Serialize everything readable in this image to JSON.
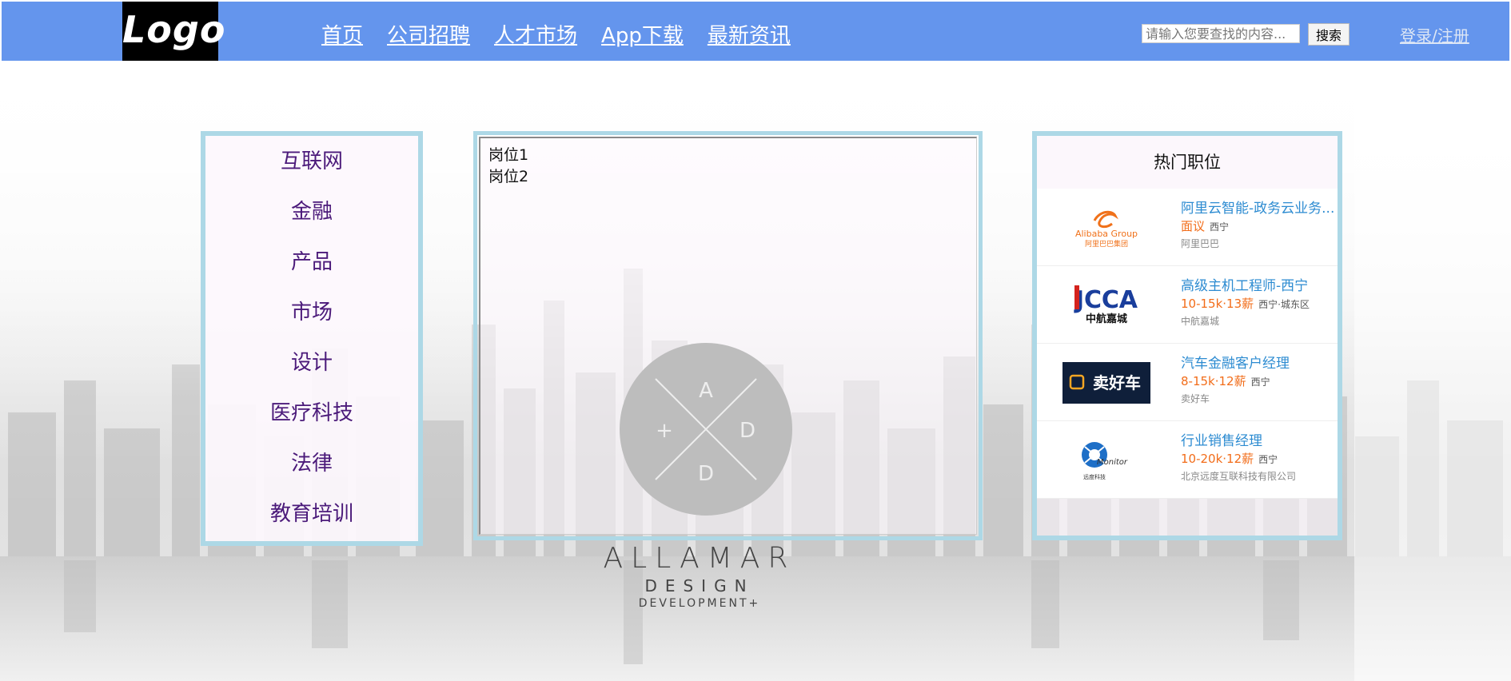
{
  "header": {
    "logo_text": "Logo",
    "nav": [
      "首页",
      "公司招聘",
      "人才市场",
      "App下载",
      "最新资讯"
    ],
    "search_placeholder": "请输入您要查找的内容...",
    "search_button": "搜索",
    "login_link": "登录/注册"
  },
  "categories": [
    "互联网",
    "金融",
    "产品",
    "市场",
    "设计",
    "医疗科技",
    "法律",
    "教育培训"
  ],
  "jobs": [
    "岗位1",
    "岗位2"
  ],
  "hot_jobs": {
    "title": "热门职位",
    "items": [
      {
        "logo_icon": "alibaba-logo",
        "logo_text": "Alibaba Group",
        "logo_subtext": "阿里巴巴集团",
        "job": "阿里云智能-政务云业务...",
        "salary": "面议",
        "city": "西宁",
        "company": "阿里巴巴"
      },
      {
        "logo_icon": "jcca-logo",
        "logo_text": "JCCA",
        "logo_subtext": "中航嘉城",
        "job": "高级主机工程师-西宁",
        "salary": "10-15k·13薪",
        "city": "西宁·城东区",
        "company": "中航嘉城"
      },
      {
        "logo_icon": "maihaoche-logo",
        "logo_text": "卖好车",
        "logo_subtext": "",
        "job": "汽车金融客户经理",
        "salary": "8-15k·12薪",
        "city": "西宁",
        "company": "卖好车"
      },
      {
        "logo_icon": "yundu-logo",
        "logo_text": "Monitor",
        "logo_subtext": "远度科技",
        "job": "行业销售经理",
        "salary": "10-20k·12薪",
        "city": "西宁",
        "company": "北京远度互联科技有限公司"
      }
    ]
  },
  "brand": {
    "line1": "ALLAMAR",
    "line2": "DESIGN",
    "line3": "DEVELOPMENT",
    "plus": "+",
    "emblem_letters": [
      "A",
      "D",
      "D",
      "+"
    ]
  },
  "colors": {
    "header_bg": "#6495ed",
    "panel_border": "#add8e6",
    "category_text": "#4b1a7a",
    "job_title": "#2c8bd1",
    "salary": "#f26d1a"
  }
}
